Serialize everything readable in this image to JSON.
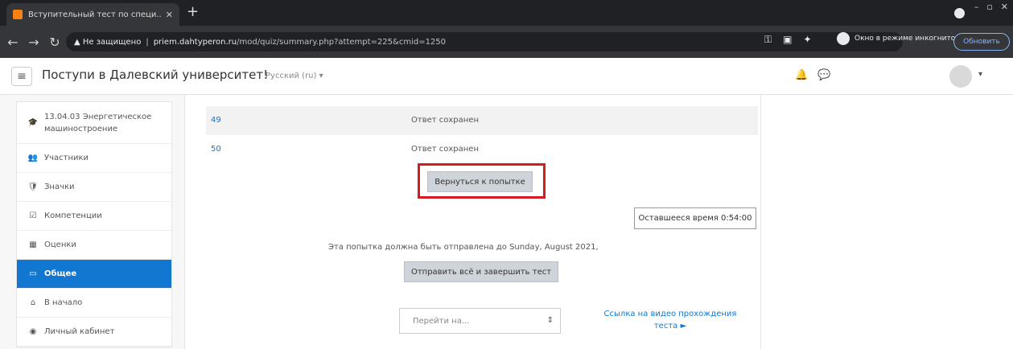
{
  "browser": {
    "tab_title": "Вступительный тест по специ...",
    "tab_close": "✕",
    "new_tab": "+",
    "window_controls": [
      "–",
      "▫",
      "✕"
    ],
    "url_warning": "▲ Не защищено",
    "url_host": "priem.dahtyperon.ru",
    "url_path": "/mod/quiz/summary.php?attempt=225&cmid=1250",
    "incognito_label": "Окно в режиме инкогнито",
    "update_label": "Обновить"
  },
  "navbar": {
    "site_name": "Поступи в Далевский университет!",
    "lang": "Русский (ru) ▾"
  },
  "drawer": {
    "items": [
      {
        "icon": "graduation-cap-icon",
        "glyph": "🎓",
        "label": "13.04.03 Энергетическое машиностроение"
      },
      {
        "icon": "users-icon",
        "glyph": "👥",
        "label": "Участники"
      },
      {
        "icon": "badge-icon",
        "glyph": "🛡",
        "label": "Значки"
      },
      {
        "icon": "check-square-icon",
        "glyph": "☑",
        "label": "Компетенции"
      },
      {
        "icon": "grades-table-icon",
        "glyph": "▦",
        "label": "Оценки"
      },
      {
        "icon": "folder-icon",
        "glyph": "▭",
        "label": "Общее"
      },
      {
        "icon": "home-icon",
        "glyph": "⌂",
        "label": "В начало"
      },
      {
        "icon": "dashboard-icon",
        "glyph": "◉",
        "label": "Личный кабинет"
      }
    ]
  },
  "main": {
    "rows": [
      {
        "num": "49",
        "status": "Ответ сохранен"
      },
      {
        "num": "50",
        "status": "Ответ сохранен"
      }
    ],
    "return_button": "Вернуться к попытке",
    "timer": "Оставшееся время 0:54:00",
    "deadline": "Эта попытка должна быть отправлена до Sunday,   August 2021,",
    "submit_button": "Отправить всё и завершить тест",
    "jump_placeholder": "Перейти на...",
    "jump_caret": "⇕",
    "video_link": "Ссылка на видео прохождения теста ►"
  },
  "colors": {
    "highlight": "#d71920",
    "accent": "#1177d1"
  }
}
